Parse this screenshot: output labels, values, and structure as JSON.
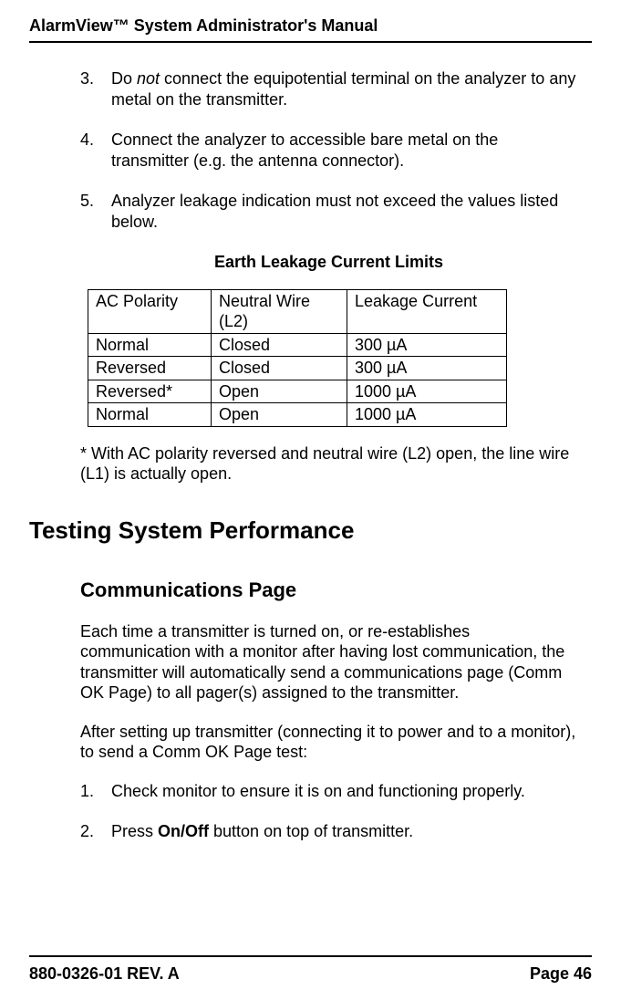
{
  "header": {
    "title": "AlarmView™ System Administrator's Manual"
  },
  "list1": [
    {
      "num": "3.",
      "pre": "Do ",
      "em": "not",
      "post": " connect the equipotential terminal on the analyzer to any metal on the transmitter."
    },
    {
      "num": "4.",
      "text": "Connect the analyzer to accessible bare metal on the transmitter (e.g. the antenna connector)."
    },
    {
      "num": "5.",
      "text": "Analyzer leakage indication must not exceed the values listed below."
    }
  ],
  "table": {
    "title": "Earth Leakage Current Limits",
    "headers": [
      "AC Polarity",
      "Neutral Wire (L2)",
      "Leakage Current"
    ],
    "rows": [
      [
        "Normal",
        "Closed",
        "300 µA"
      ],
      [
        "Reversed",
        "Closed",
        "300 µA"
      ],
      [
        "Reversed*",
        "Open",
        "1000 µA"
      ],
      [
        "Normal",
        "Open",
        "1000 µA"
      ]
    ]
  },
  "note": "* With AC polarity reversed and neutral wire (L2) open, the line wire (L1) is actually open.",
  "section": {
    "title": "Testing System Performance"
  },
  "sub": {
    "title": "Communications Page"
  },
  "para1": "Each time a transmitter is turned on, or re-establishes communication with a monitor after having lost communication, the transmitter will automatically send a communications page (Comm OK Page) to all pager(s) assigned to the transmitter.",
  "para2": "After setting up transmitter (connecting it to power and to a monitor), to send a Comm OK Page test:",
  "list2": [
    {
      "num": "1.",
      "text": "Check monitor to ensure it is on and functioning properly."
    },
    {
      "num": "2.",
      "pre": "Press ",
      "em": "On/Off",
      "post": " button on top of transmitter."
    }
  ],
  "footer": {
    "left": "880-0326-01 REV. A",
    "right": "Page 46"
  }
}
